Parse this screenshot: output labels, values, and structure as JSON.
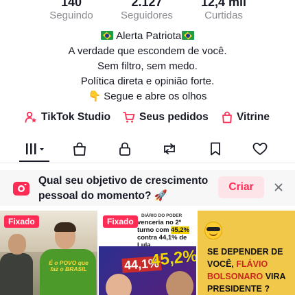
{
  "stats": [
    {
      "value": "140",
      "label": "Seguindo"
    },
    {
      "value": "2.127",
      "label": "Seguidores"
    },
    {
      "value": "12,4 mil",
      "label": "Curtidas"
    }
  ],
  "bio": {
    "name_line": "Alerta Patriota",
    "lines": [
      "A verdade que escondem de você.",
      "Sem filtro, sem medo.",
      "Política direta e opinião forte.",
      "Segue e abre os olhos"
    ]
  },
  "actions": [
    {
      "label": "TikTok Studio",
      "icon": "studio-person-star-icon"
    },
    {
      "label": "Seus pedidos",
      "icon": "cart-icon"
    },
    {
      "label": "Vitrine",
      "icon": "shopping-bag-icon"
    }
  ],
  "tabs": [
    {
      "name": "videos-grid",
      "icon": "grid-bars-icon",
      "active": true
    },
    {
      "name": "shop",
      "icon": "bag-icon"
    },
    {
      "name": "private",
      "icon": "lock-icon"
    },
    {
      "name": "reposts",
      "icon": "repost-icon"
    },
    {
      "name": "favorites",
      "icon": "bookmark-icon"
    },
    {
      "name": "liked",
      "icon": "heart-icon"
    }
  ],
  "prompt": {
    "text": "Qual seu objetivo de crescimento pessoal do momento? 🚀",
    "button": "Criar",
    "close_icon": "close-icon"
  },
  "videos": [
    {
      "badge": "Fixado",
      "shirt_text": "É o POVO que faz o BRASIL"
    },
    {
      "badge": "Fixado",
      "source": "DIÁRIO DO PODER",
      "headline_pre": "venceria no 2º turno com ",
      "headline_hl": "45,2%",
      "headline_post": " contra 44,1% de Lula",
      "pct_left": "44,1%",
      "pct_right": "45,2%"
    },
    {
      "headline_pre": "SE DEPENDER DE VOCÊ, ",
      "headline_red": "FLÁVIO BOLSONARO",
      "headline_post": " VIRA PRESIDENTE ?"
    }
  ],
  "colors": {
    "accent": "#fe2c55",
    "text": "#161823",
    "muted": "#8a8b91"
  }
}
